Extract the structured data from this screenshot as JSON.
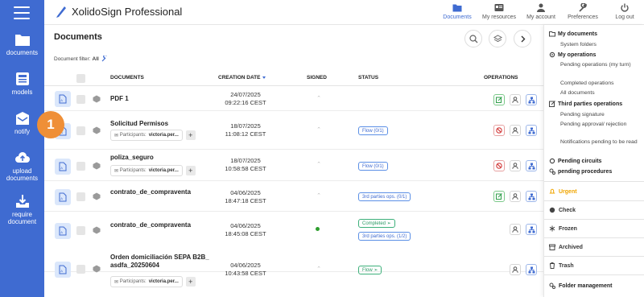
{
  "app": {
    "title": "XolidoSign Professional"
  },
  "sidebar": {
    "items": [
      {
        "label": "documents"
      },
      {
        "label": "models"
      },
      {
        "label": "notify"
      },
      {
        "label": "upload documents"
      },
      {
        "label": "require document"
      }
    ]
  },
  "topnav": {
    "items": [
      {
        "label": "Documents",
        "active": true
      },
      {
        "label": "My resources"
      },
      {
        "label": "My account"
      },
      {
        "label": "Preferences"
      },
      {
        "label": "Log out"
      }
    ]
  },
  "page": {
    "title": "Documents",
    "filter_label": "Document filter:",
    "filter_value": "All"
  },
  "table": {
    "headers": {
      "documents": "DOCUMENTS",
      "creation_date": "CREATION DATE",
      "signed": "SIGNED",
      "status": "STATUS",
      "operations": "OPERATIONS"
    },
    "rows": [
      {
        "name": "PDF 1",
        "date": "24/07/2025",
        "time": "09:22:16 CEST",
        "signed": "unsigned"
      },
      {
        "name": "Solicitud Permisos",
        "participants_label": "Participants:",
        "participants": "victoria.per...",
        "date": "18/07/2025",
        "time": "11:08:12 CEST",
        "signed": "unsigned",
        "status": [
          "Flow (0/1)"
        ]
      },
      {
        "name": "poliza_seguro",
        "participants_label": "Participants:",
        "participants": "victoria.per...",
        "date": "18/07/2025",
        "time": "10:58:58 CEST",
        "signed": "unsigned",
        "status": [
          "Flow (0/1)"
        ]
      },
      {
        "name": "contrato_de_compraventa",
        "date": "04/06/2025",
        "time": "18:47:18 CEST",
        "signed": "unsigned",
        "status": [
          "3rd parties ops. (0/1)"
        ]
      },
      {
        "name": "contrato_de_compraventa",
        "date": "04/06/2025",
        "time": "18:45:08 CEST",
        "signed": "signed",
        "status": [
          "Completed",
          "3rd parties ops. (1/2)"
        ]
      },
      {
        "name": "Orden domiciliación SEPA B2B_asdfa_20250604",
        "participants_label": "Participants:",
        "participants": "victoria.per...",
        "date": "04/06/2025",
        "time": "10:43:58 CEST",
        "signed": "unsigned",
        "status": [
          "Flow"
        ]
      }
    ]
  },
  "step_marker": "1",
  "right_panel": {
    "my_documents": "My documents",
    "system_folders": "System folders",
    "my_operations": "My operations",
    "my_operations_items": [
      "Pending operations (my turn)",
      "Completed operations",
      "All documents"
    ],
    "third_parties": "Third parties operations",
    "third_parties_items": [
      "Pending signature",
      "Pending approval/ rejection",
      "Notifications pending to be read"
    ],
    "pending_circuits": "Pending circuits",
    "pending_procedures": "pending procedures",
    "urgent": "Urgent",
    "check": "Check",
    "frozen": "Frozen",
    "archived": "Archived",
    "trash": "Trash",
    "folder_management": "Folder management"
  },
  "colors": {
    "sidebar": "#3f6bd1",
    "accent": "#3f6bd1",
    "urgent": "#f0a500",
    "step": "#ef8f37"
  }
}
